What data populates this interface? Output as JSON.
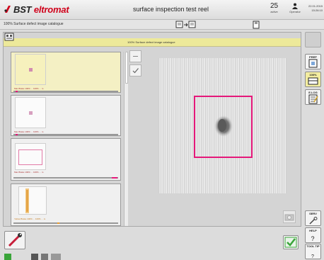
{
  "header": {
    "brand_main": "BST",
    "brand_accent": "eltromat",
    "app_title": "surface inspection test reel",
    "counter_value": "25",
    "counter_label": "active",
    "operator_label": "Operator",
    "date": "22.01.2015",
    "time": "15:26:10"
  },
  "subheader": {
    "breadcrumb": "100% Surface defect image catalogue"
  },
  "panel": {
    "title": "100% Surface defect image catalogue"
  },
  "thumbnails": [
    {
      "label": "Max Brake 100% ... 100% ... m",
      "marker": 0.02,
      "selected": true,
      "marker_color": "#e5187a"
    },
    {
      "label": "Max Brake 100% ... 100% ... m",
      "marker": 0.02,
      "selected": false,
      "marker_color": "#e5187a"
    },
    {
      "label": "Max Brake 100% ... 100% ... m",
      "marker": 0.97,
      "selected": false,
      "marker_color": "#e5187a"
    },
    {
      "label": "Yellow Brake 100% ... 100% ... m",
      "marker": 0.42,
      "selected": false,
      "marker_color": "#e89a2c"
    }
  ],
  "right_toolbar": {
    "prep": "PREP",
    "pct100": "100%",
    "elog": "E.LOG",
    "serv": "SERV",
    "help": "HELP",
    "tooltip": "TOOL TIP"
  },
  "colors": {
    "highlight": "#ede99a",
    "defect_box": "#e5187a",
    "brand_red": "#d0021b",
    "ok_green": "#3aa53a"
  }
}
